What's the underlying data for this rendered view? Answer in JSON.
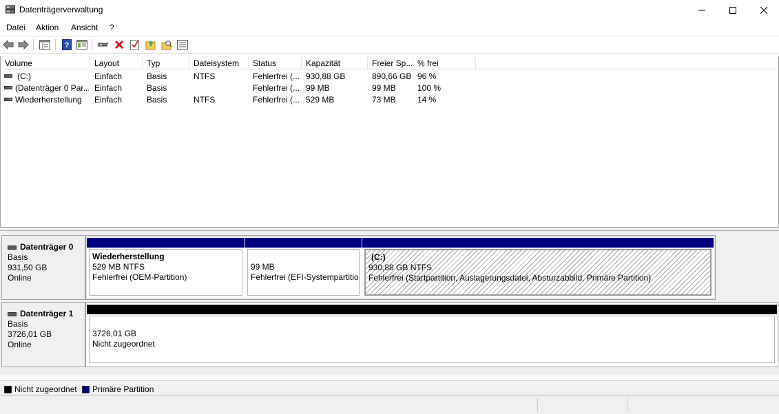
{
  "window": {
    "title": "Datenträgerverwaltung"
  },
  "menu": [
    "Datei",
    "Aktion",
    "Ansicht",
    "?"
  ],
  "toolbar": {
    "icons": [
      "back-arrow-icon",
      "forward-arrow-icon",
      "console-tree-icon",
      "help-icon",
      "properties-icon",
      "connect-icon",
      "delete-icon",
      "checkmark-icon",
      "folder-up-icon",
      "folder-search-icon",
      "list-icon"
    ],
    "delete_color": "#d61b1b"
  },
  "volume_list": {
    "columns": [
      "Volume",
      "Layout",
      "Typ",
      "Dateisystem",
      "Status",
      "Kapazität",
      "Freier Sp...",
      "% frei"
    ],
    "rows": [
      [
        "(C:)",
        "Einfach",
        "Basis",
        "NTFS",
        "Fehlerfrei (...",
        "930,88 GB",
        "890,66 GB",
        "96 %"
      ],
      [
        "(Datenträger 0 Par...",
        "Einfach",
        "Basis",
        "",
        "Fehlerfrei (...",
        "99 MB",
        "99 MB",
        "100 %"
      ],
      [
        "Wiederherstellung",
        "Einfach",
        "Basis",
        "NTFS",
        "Fehlerfrei (...",
        "529 MB",
        "73 MB",
        "14 %"
      ]
    ]
  },
  "disks": [
    {
      "name": "Datenträger 0",
      "type": "Basis",
      "size": "931,50 GB",
      "state": "Online",
      "partitions": [
        {
          "name": "Wiederherstellung",
          "size": "529 MB NTFS",
          "status": "Fehlerfrei (OEM-Partition)",
          "kind": "primary"
        },
        {
          "name": "",
          "size": "99 MB",
          "status": "Fehlerfrei (EFI-Systempartition)",
          "kind": "primary"
        },
        {
          "name": "(C:)",
          "size": "930,88 GB NTFS",
          "status": "Fehlerfrei (Startpartition, Auslagerungsdatei, Absturzabbild, Primäre Partition)",
          "kind": "primary-selected"
        }
      ]
    },
    {
      "name": "Datenträger 1",
      "type": "Basis",
      "size": "3726,01 GB",
      "state": "Online",
      "partitions": [
        {
          "name": "",
          "size": "3726,01 GB",
          "status": "Nicht zugeordnet",
          "kind": "unallocated"
        }
      ]
    }
  ],
  "legend": {
    "unallocated": {
      "label": "Nicht zugeordnet",
      "color": "#000000"
    },
    "primary": {
      "label": "Primäre Partition",
      "color": "#000080"
    }
  }
}
